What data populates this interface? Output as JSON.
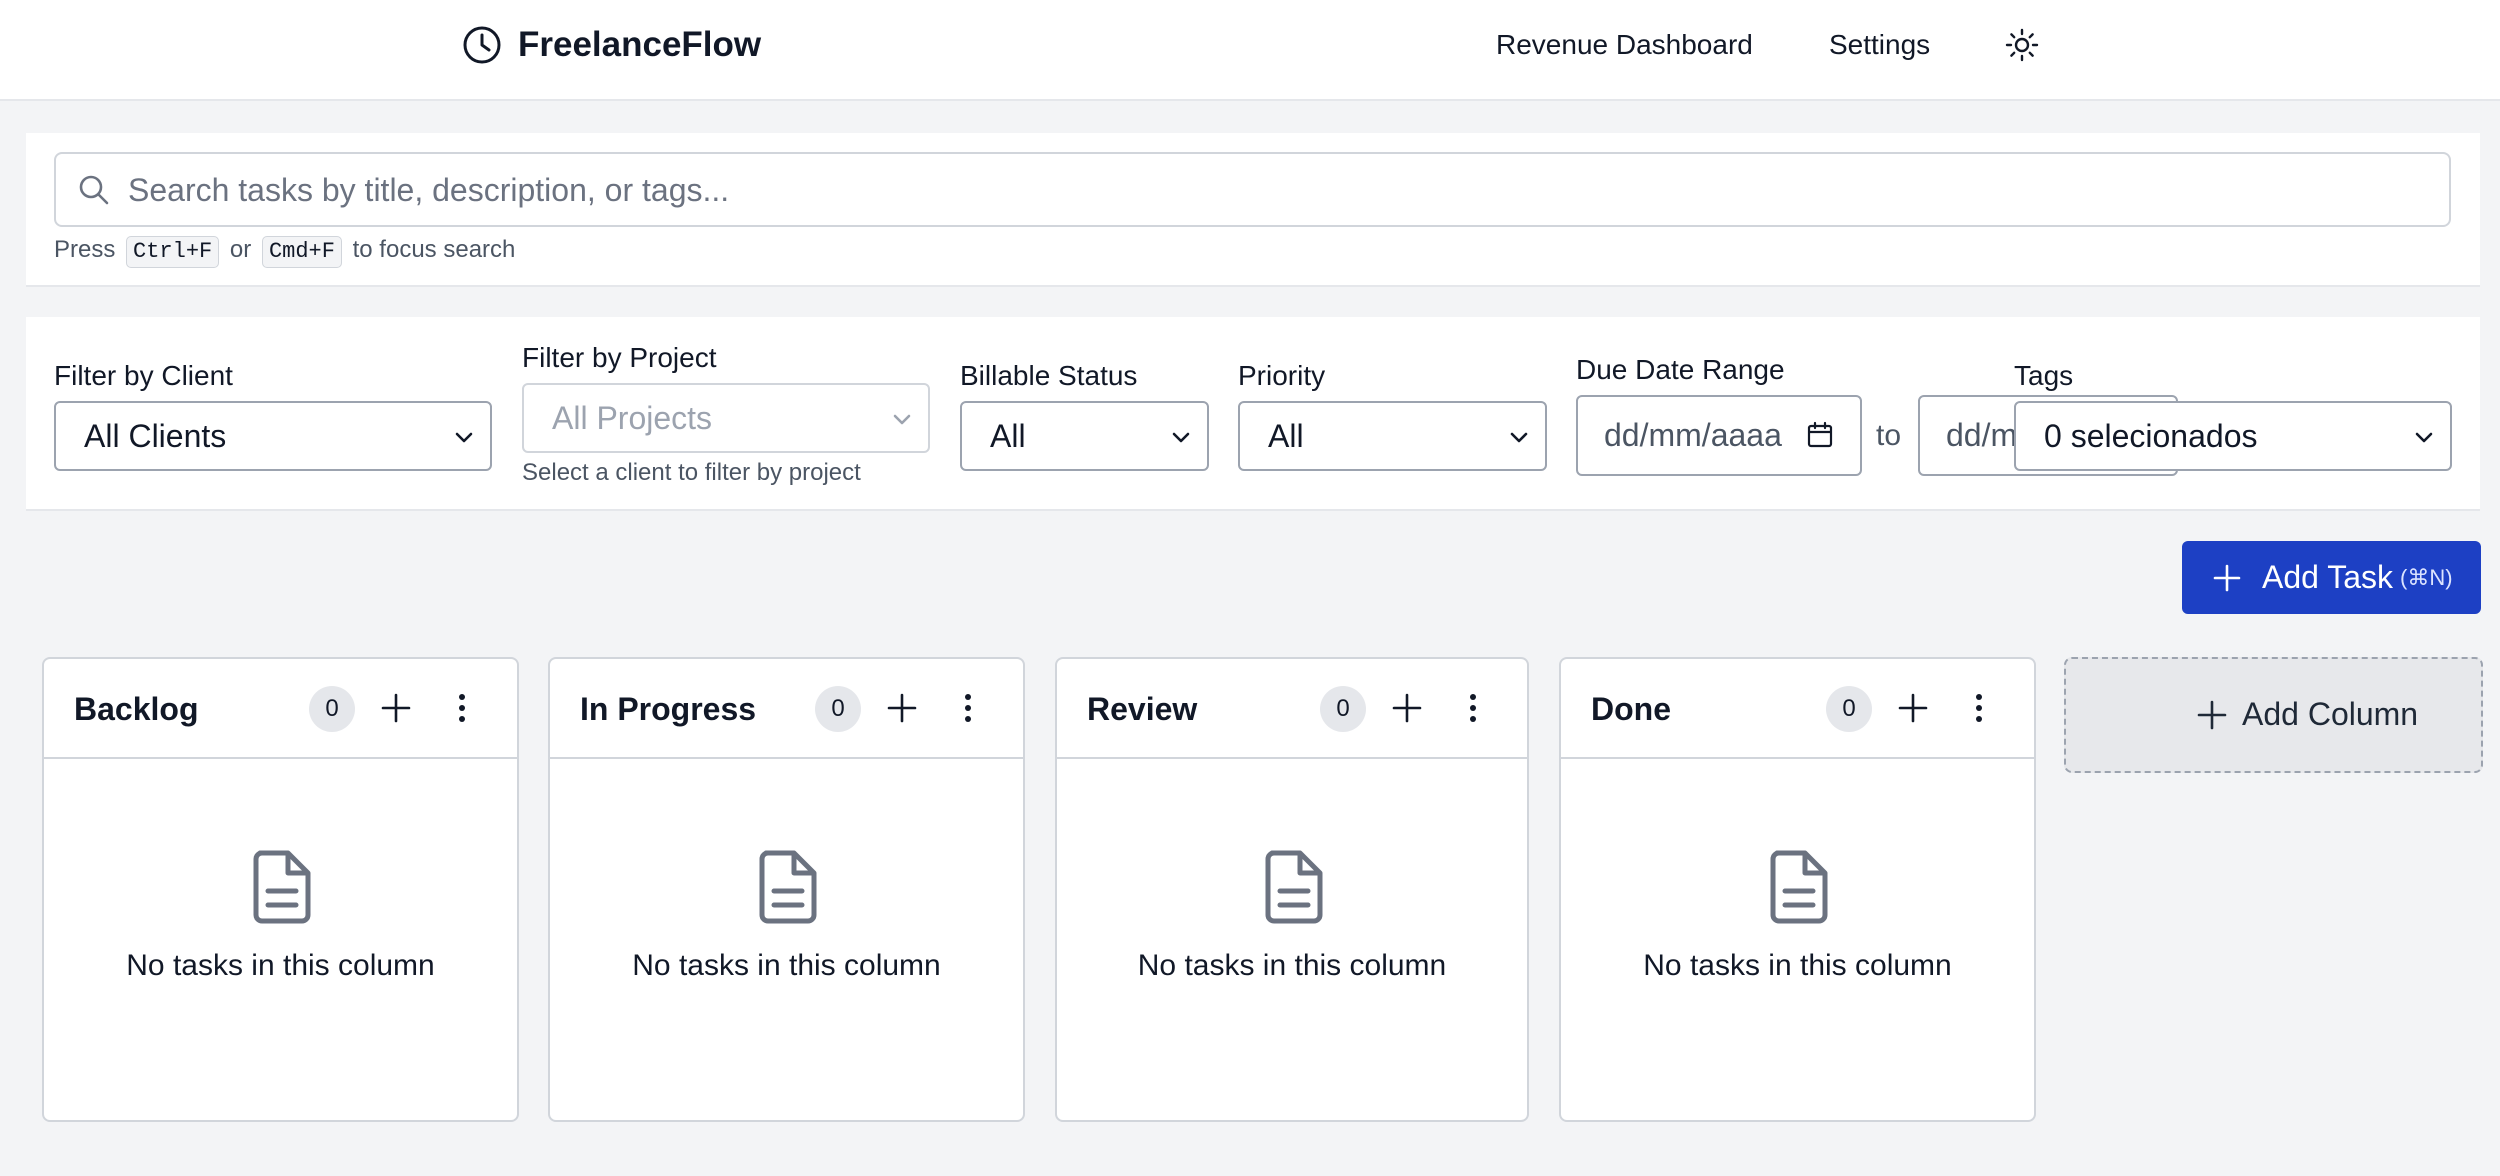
{
  "header": {
    "app_title": "FreelanceFlow",
    "nav": [
      {
        "label": "Revenue Dashboard"
      },
      {
        "label": "Settings"
      }
    ]
  },
  "search": {
    "placeholder": "Search tasks by title, description, or tags...",
    "value": "",
    "hint_prefix": "Press",
    "hint_key1": "Ctrl+F",
    "hint_or": "or",
    "hint_key2": "Cmd+F",
    "hint_suffix": "to focus search"
  },
  "filters": {
    "client": {
      "label": "Filter by Client",
      "value": "All Clients"
    },
    "project": {
      "label": "Filter by Project",
      "value": "All Projects",
      "hint": "Select a client to filter by project"
    },
    "billable": {
      "label": "Billable Status",
      "value": "All"
    },
    "priority": {
      "label": "Priority",
      "value": "All"
    },
    "due_date": {
      "label": "Due Date Range",
      "from_placeholder": "dd/mm/aaaa",
      "to_label": "to",
      "to_placeholder": "dd/m"
    },
    "tags": {
      "label": "Tags",
      "value": "0 selecionados"
    }
  },
  "actions": {
    "add_task_label": "Add Task",
    "add_task_shortcut": "(⌘N)",
    "add_column_label": "Add Column"
  },
  "board": {
    "empty_text": "No tasks in this column",
    "columns": [
      {
        "title": "Backlog",
        "count": "0"
      },
      {
        "title": "In Progress",
        "count": "0"
      },
      {
        "title": "Review",
        "count": "0"
      },
      {
        "title": "Done",
        "count": "0"
      }
    ]
  },
  "colors": {
    "primary": "#1d40c4",
    "background": "#f3f4f6",
    "panel": "#ffffff",
    "border": "#d1d5db"
  },
  "icons": [
    "clock-icon",
    "sun-icon",
    "search-icon",
    "chevron-down-icon",
    "calendar-icon",
    "plus-icon",
    "more-vertical-icon",
    "document-icon"
  ]
}
